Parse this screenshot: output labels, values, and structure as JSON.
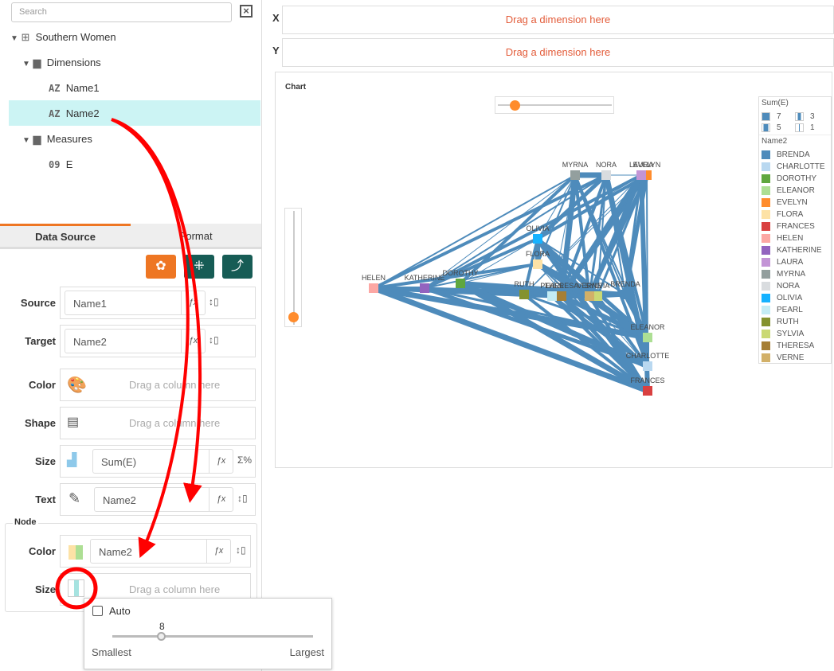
{
  "sidebar": {
    "search_placeholder": "Search",
    "tree": {
      "dataset": "Southern Women",
      "dimensions": "Dimensions",
      "dim_items": [
        {
          "type": "AZ",
          "name": "Name1"
        },
        {
          "type": "AZ",
          "name": "Name2"
        }
      ],
      "measures": "Measures",
      "measure_items": [
        {
          "type": "09",
          "name": "E"
        }
      ]
    },
    "selected": "Name2"
  },
  "tabs": [
    {
      "label": "Data Source",
      "active": true
    },
    {
      "label": "Format",
      "active": false
    }
  ],
  "fields": {
    "source": {
      "label": "Source",
      "value": "Name1"
    },
    "target": {
      "label": "Target",
      "value": "Name2"
    },
    "color": {
      "label": "Color",
      "hint": "Drag a column here"
    },
    "shape": {
      "label": "Shape",
      "hint": "Drag a column here"
    },
    "size": {
      "label": "Size",
      "value": "Sum(E)"
    },
    "text": {
      "label": "Text",
      "value": "Name2"
    }
  },
  "node": {
    "title": "Node",
    "color": {
      "label": "Color",
      "value": "Name2"
    },
    "size": {
      "label": "Size",
      "hint": "Drag a column here"
    }
  },
  "size_popup": {
    "auto_label": "Auto",
    "auto_checked": false,
    "value": "8",
    "min_label": "Smallest",
    "max_label": "Largest",
    "fraction": 0.25
  },
  "shelves": {
    "x_label": "X",
    "y_label": "Y",
    "x_hint": "Drag a dimension here",
    "y_hint": "Drag a dimension here"
  },
  "chart": {
    "title": "Chart",
    "edge_color": "#4e8bbb",
    "legend": {
      "size_title": "Sum(E)",
      "sizes": [
        "7",
        "3",
        "5",
        "1"
      ],
      "color_title": "Name2",
      "items": [
        {
          "name": "BRENDA",
          "color": "#4e8bbb"
        },
        {
          "name": "CHARLOTTE",
          "color": "#b9d8f0"
        },
        {
          "name": "DOROTHY",
          "color": "#5fa73f"
        },
        {
          "name": "ELEANOR",
          "color": "#addf94"
        },
        {
          "name": "EVELYN",
          "color": "#ff8c2d"
        },
        {
          "name": "FLORA",
          "color": "#fde2a6"
        },
        {
          "name": "FRANCES",
          "color": "#d94040"
        },
        {
          "name": "HELEN",
          "color": "#fca7a4"
        },
        {
          "name": "KATHERINE",
          "color": "#9363bf"
        },
        {
          "name": "LAURA",
          "color": "#c394d6"
        },
        {
          "name": "MYRNA",
          "color": "#939f9e"
        },
        {
          "name": "NORA",
          "color": "#d9dcdf"
        },
        {
          "name": "OLIVIA",
          "color": "#16b2ff"
        },
        {
          "name": "PEARL",
          "color": "#c4ecf4"
        },
        {
          "name": "RUTH",
          "color": "#84922e"
        },
        {
          "name": "SYLVIA",
          "color": "#cad974"
        },
        {
          "name": "THERESA",
          "color": "#a67f35"
        },
        {
          "name": "VERNE",
          "color": "#d2b068"
        }
      ]
    }
  }
}
